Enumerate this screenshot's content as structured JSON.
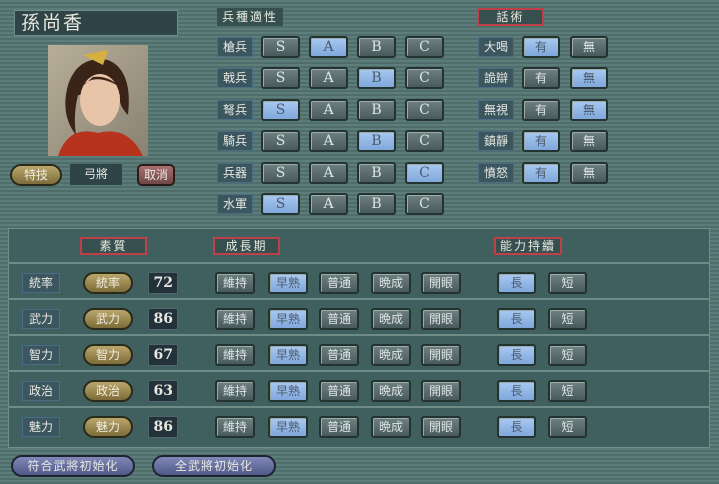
{
  "officer": {
    "name": "孫尚香",
    "skill_button": "特技",
    "skill_value": "弓將",
    "cancel_button": "取消"
  },
  "troop_aptitude": {
    "title": "兵種適性",
    "grades": [
      "S",
      "A",
      "B",
      "C"
    ],
    "rows": [
      {
        "label": "槍兵",
        "selected": "A"
      },
      {
        "label": "戟兵",
        "selected": "B"
      },
      {
        "label": "弩兵",
        "selected": "S"
      },
      {
        "label": "騎兵",
        "selected": "B"
      },
      {
        "label": "兵器",
        "selected": "C"
      },
      {
        "label": "水軍",
        "selected": "S"
      }
    ]
  },
  "speech": {
    "title": "話術",
    "options": [
      "有",
      "無"
    ],
    "rows": [
      {
        "label": "大喝",
        "selected": "有"
      },
      {
        "label": "詭辯",
        "selected": "無"
      },
      {
        "label": "無視",
        "selected": "無"
      },
      {
        "label": "鎮靜",
        "selected": "有"
      },
      {
        "label": "憤怒",
        "selected": "有"
      }
    ]
  },
  "stats": {
    "quality_header": "素質",
    "growth_header": "成長期",
    "duration_header": "能力持續",
    "growth_options": [
      "維持",
      "早熟",
      "普通",
      "晩成",
      "開眼"
    ],
    "duration_options": [
      "長",
      "短"
    ],
    "rows": [
      {
        "label": "統率",
        "button": "統率",
        "value": "72",
        "growth": "早熟",
        "duration": "長"
      },
      {
        "label": "武力",
        "button": "武力",
        "value": "86",
        "growth": "早熟",
        "duration": "長"
      },
      {
        "label": "智力",
        "button": "智力",
        "value": "67",
        "growth": "早熟",
        "duration": "長"
      },
      {
        "label": "政治",
        "button": "政治",
        "value": "63",
        "growth": "早熟",
        "duration": "長"
      },
      {
        "label": "魅力",
        "button": "魅力",
        "value": "86",
        "growth": "早熟",
        "duration": "長"
      }
    ]
  },
  "footer": {
    "reset_matching": "符合武將初始化",
    "reset_all": "全武將初始化"
  }
}
